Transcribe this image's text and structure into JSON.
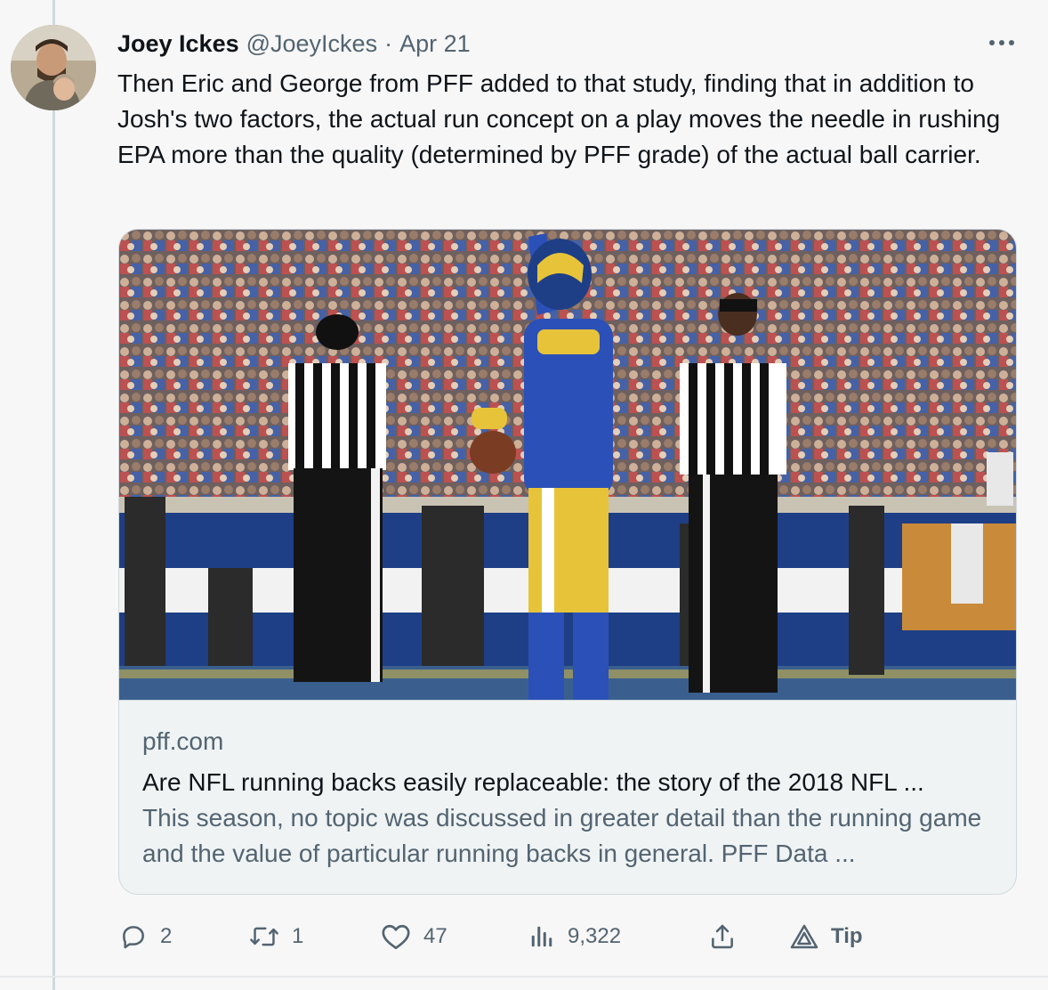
{
  "tweet": {
    "author_name": "Joey Ickes",
    "handle": "@JoeyIckes",
    "separator": "·",
    "date": "Apr 21",
    "more_label": "···",
    "text": "Then Eric and George from PFF added to that study, finding that in addition to Josh's two factors, the actual run concept on a play moves the needle in rushing EPA more than the quality (determined by PFF grade) of the actual ball carrier."
  },
  "card": {
    "image_alt": "Football player in blue and yellow uniform number 35 celebrating with ball between two referees, crowd in background",
    "domain": "pff.com",
    "title": "Are NFL running backs easily replaceable: the story of the 2018 NFL ...",
    "description": "This season, no topic was discussed in greater detail than the running game and the value of particular running backs in general. PFF Data ..."
  },
  "actions": {
    "reply_count": "2",
    "retweet_count": "1",
    "like_count": "47",
    "views_count": "9,322",
    "tip_label": "Tip"
  },
  "icons": [
    "reply-icon",
    "retweet-icon",
    "like-icon",
    "views-icon",
    "share-icon",
    "tip-icon",
    "more-icon"
  ],
  "colors": {
    "text_primary": "#0f1419",
    "text_secondary": "#536471",
    "border": "#cfd9de",
    "background": "#f7f7f7"
  }
}
